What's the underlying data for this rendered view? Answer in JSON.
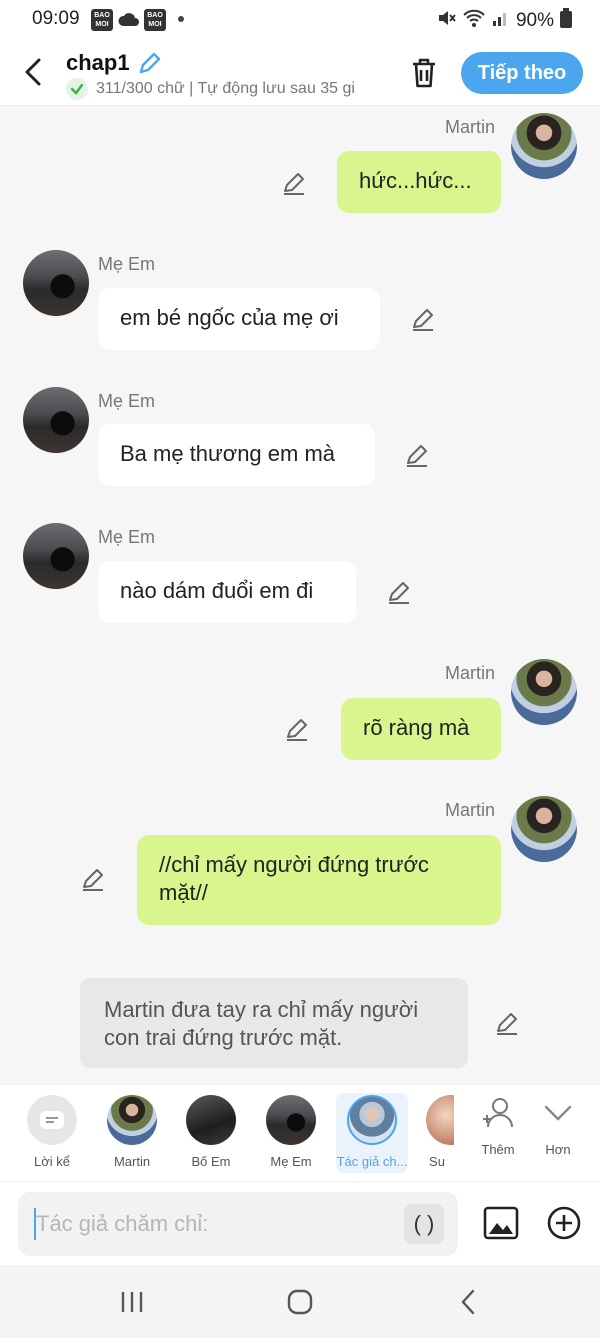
{
  "status_bar": {
    "time": "09:09",
    "badge_label": "BAO MOI",
    "battery": "90%"
  },
  "header": {
    "title": "chap1",
    "status": "311/300 chữ | Tự động lưu sau 35 gi",
    "next_label": "Tiếp theo"
  },
  "messages": [
    {
      "sender": "Martin",
      "text": "hức...hức...",
      "side": "right"
    },
    {
      "sender": "Mẹ Em",
      "text": "em bé ngốc của mẹ ơi",
      "side": "left"
    },
    {
      "sender": "Mẹ Em",
      "text": "Ba mẹ thương em mà",
      "side": "left"
    },
    {
      "sender": "Mẹ Em",
      "text": "nào dám đuổi em đi",
      "side": "left"
    },
    {
      "sender": "Martin",
      "text": "rõ ràng mà",
      "side": "right"
    },
    {
      "sender": "Martin",
      "text": "//chỉ mấy người đứng trước mặt//",
      "side": "right"
    }
  ],
  "narration": "Martin đưa tay ra chỉ mấy người con trai đứng trước mặt.",
  "characters": [
    {
      "label": "Lời kể"
    },
    {
      "label": "Martin"
    },
    {
      "label": "Bố Em"
    },
    {
      "label": "Mẹ Em"
    },
    {
      "label": "Tác giả ch..."
    },
    {
      "label": "Su"
    }
  ],
  "actions": {
    "add_label": "Thêm",
    "more_label": "Hơn"
  },
  "input": {
    "placeholder": "Tác giả chăm chỉ:",
    "paren_label": "( )"
  },
  "colors": {
    "accent": "#4aa6ef",
    "bubble_right": "#d8f58e",
    "bubble_left": "#ffffff",
    "narration_bg": "#e8e8e8"
  },
  "icons": [
    "back-icon",
    "pencil-icon",
    "check-icon",
    "trash-icon",
    "person-add-icon",
    "chevron-down-icon",
    "image-icon",
    "plus-circle-icon",
    "recents-icon",
    "home-icon",
    "nav-back-icon"
  ]
}
